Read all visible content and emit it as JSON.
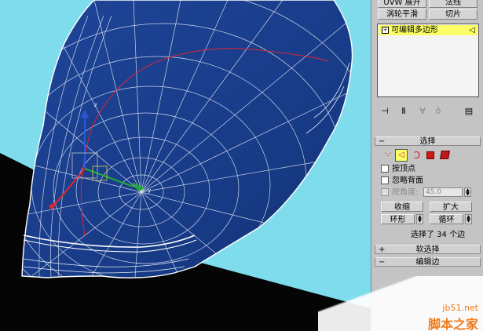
{
  "panel": {
    "top_buttons": [
      {
        "label": "UVW 展开"
      },
      {
        "label": "法线"
      },
      {
        "label": "涡轮平滑"
      },
      {
        "label": "切片"
      }
    ],
    "modifier_stack": {
      "item_label": "可编辑多边形"
    },
    "selection": {
      "title": "选择",
      "by_vertex_label": "按顶点",
      "ignore_backfacing_label": "忽略背面",
      "by_angle_label": "按角度:",
      "angle_value": "45.0",
      "shrink_label": "收缩",
      "grow_label": "扩大",
      "ring_label": "环形",
      "loop_label": "循环",
      "status": "选择了 34 个边"
    },
    "soft_selection": {
      "title": "软选择"
    },
    "edit_edges": {
      "title": "编辑边"
    }
  },
  "watermark": {
    "site": "jb51.net",
    "name": "脚本之家"
  },
  "colors": {
    "mesh_fill": "#1b3f90",
    "background_cyan": "#7edcec",
    "selection_red": "#d0263a",
    "panel_bg": "#c4c4c4"
  }
}
